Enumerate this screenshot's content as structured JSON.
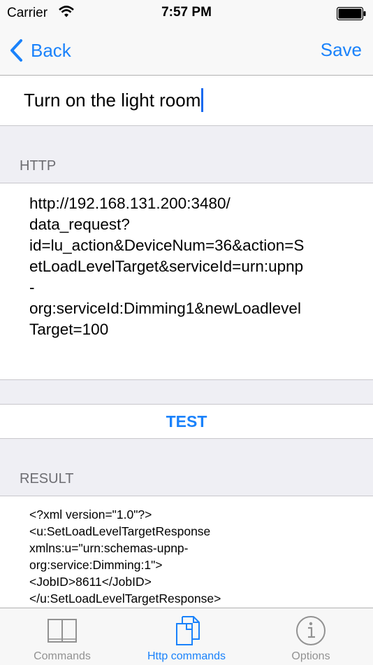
{
  "status_bar": {
    "carrier": "Carrier",
    "time": "7:57 PM"
  },
  "nav": {
    "back_label": "Back",
    "save_label": "Save"
  },
  "command_title": "Turn on the light room",
  "http_section": {
    "header": "HTTP",
    "lines": [
      "http://192.168.131.200:3480/",
      "data_request?",
      "id=lu_action&DeviceNum=36&action=S",
      "etLoadLevelTarget&serviceId=urn:upnp",
      "-",
      "org:serviceId:Dimming1&newLoadlevel",
      "Target=100"
    ]
  },
  "test_button_label": "TEST",
  "result_section": {
    "header": "RESULT",
    "lines": [
      "<?xml version=\"1.0\"?>",
      "<u:SetLoadLevelTargetResponse",
      "xmlns:u=\"urn:schemas-upnp-",
      "org:service:Dimming:1\">",
      "<JobID>8611</JobID>",
      "</u:SetLoadLevelTargetResponse>"
    ]
  },
  "tabs": [
    {
      "label": "Commands",
      "icon": "book-icon",
      "active": false
    },
    {
      "label": "Http commands",
      "icon": "documents-icon",
      "active": true
    },
    {
      "label": "Options",
      "icon": "info-icon",
      "active": false
    }
  ],
  "colors": {
    "accent": "#1a82fb",
    "inactive_tab": "#929292",
    "background": "#efeff4",
    "section_header": "#6d6d72"
  }
}
